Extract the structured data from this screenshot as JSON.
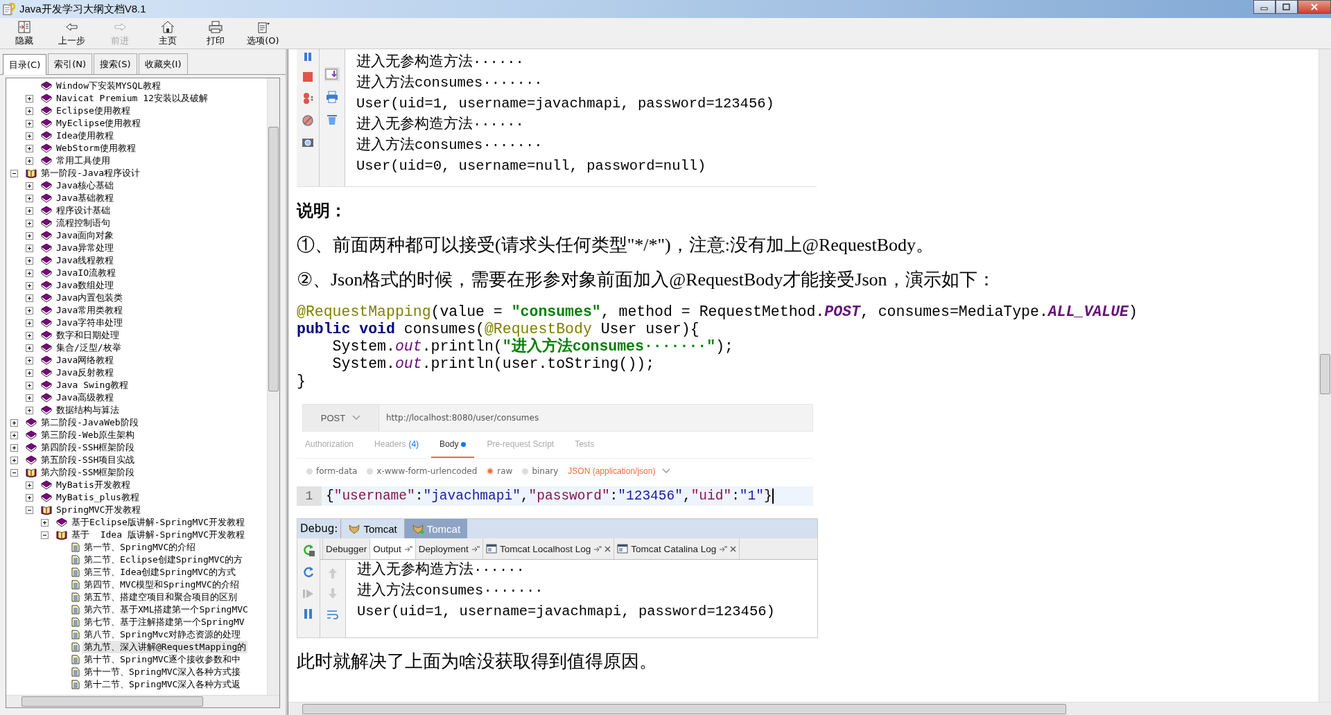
{
  "window": {
    "title": "Java开发学习大纲文档V8.1"
  },
  "toolbar": [
    {
      "label": "隐藏",
      "kind": "hide",
      "disabled": false
    },
    {
      "label": "上一步",
      "kind": "back",
      "disabled": false
    },
    {
      "label": "前进",
      "kind": "forward",
      "disabled": true
    },
    {
      "label": "主页",
      "kind": "home",
      "disabled": false
    },
    {
      "label": "打印",
      "kind": "print",
      "disabled": false
    },
    {
      "label": "选项(O)",
      "kind": "options",
      "disabled": false
    }
  ],
  "nav_tabs": [
    {
      "label": "目录(C)",
      "selected": true
    },
    {
      "label": "索引(N)",
      "selected": false
    },
    {
      "label": "搜索(S)",
      "selected": false
    },
    {
      "label": "收藏夹(I)",
      "selected": false
    }
  ],
  "tree": {
    "scrolled_items": [
      {
        "label": "Window下安装MYSQL教程",
        "kind": "book",
        "selected": false
      },
      {
        "label": "Navicat Premium 12安装以及破解",
        "kind": "book",
        "expanded": false,
        "selected": false
      },
      {
        "label": "Eclipse使用教程",
        "kind": "book",
        "expanded": false,
        "selected": false
      },
      {
        "label": "MyEclipse使用教程",
        "kind": "book",
        "expanded": false,
        "selected": false
      },
      {
        "label": "Idea使用教程",
        "kind": "book",
        "expanded": false,
        "selected": false
      },
      {
        "label": "WebStorm使用教程",
        "kind": "book",
        "expanded": false,
        "selected": false
      },
      {
        "label": "常用工具使用",
        "kind": "book",
        "expanded": false,
        "selected": false
      }
    ],
    "items": [
      {
        "label": "第一阶段-Java程序设计",
        "kind": "open-book",
        "expanded": true,
        "selected": false,
        "children": [
          {
            "label": "Java核心基础",
            "kind": "book",
            "expanded": false,
            "selected": false
          },
          {
            "label": "Java基础教程",
            "kind": "book",
            "expanded": false,
            "selected": false
          },
          {
            "label": "程序设计基础",
            "kind": "book",
            "expanded": false,
            "selected": false
          },
          {
            "label": "流程控制语句",
            "kind": "book",
            "expanded": false,
            "selected": false
          },
          {
            "label": "Java面向对象",
            "kind": "book",
            "expanded": false,
            "selected": false
          },
          {
            "label": "Java异常处理",
            "kind": "book",
            "expanded": false,
            "selected": false
          },
          {
            "label": "Java线程教程",
            "kind": "book",
            "expanded": false,
            "selected": false
          },
          {
            "label": "JavaIO流教程",
            "kind": "book",
            "expanded": false,
            "selected": false
          },
          {
            "label": "Java数组处理",
            "kind": "book",
            "expanded": false,
            "selected": false
          },
          {
            "label": "Java内置包装类",
            "kind": "book",
            "expanded": false,
            "selected": false
          },
          {
            "label": "Java常用类教程",
            "kind": "book",
            "expanded": false,
            "selected": false
          },
          {
            "label": "Java字符串处理",
            "kind": "book",
            "expanded": false,
            "selected": false
          },
          {
            "label": "数字和日期处理",
            "kind": "book",
            "expanded": false,
            "selected": false
          },
          {
            "label": "集合/泛型/枚举",
            "kind": "book",
            "expanded": false,
            "selected": false
          },
          {
            "label": "Java网络教程",
            "kind": "book",
            "expanded": false,
            "selected": false
          },
          {
            "label": "Java反射教程",
            "kind": "book",
            "expanded": false,
            "selected": false
          },
          {
            "label": "Java Swing教程",
            "kind": "book",
            "expanded": false,
            "selected": false
          },
          {
            "label": "Java高级教程",
            "kind": "book",
            "expanded": false,
            "selected": false
          },
          {
            "label": "数据结构与算法",
            "kind": "book",
            "expanded": false,
            "selected": false
          }
        ]
      },
      {
        "label": "第二阶段-JavaWeb阶段",
        "kind": "book",
        "expanded": false,
        "selected": false
      },
      {
        "label": "第三阶段-Web原生架构",
        "kind": "book",
        "expanded": false,
        "selected": false
      },
      {
        "label": "第四阶段-SSH框架阶段",
        "kind": "book",
        "expanded": false,
        "selected": false
      },
      {
        "label": "第五阶段-SSH项目实战",
        "kind": "book",
        "expanded": false,
        "selected": false
      },
      {
        "label": "第六阶段-SSM框架阶段",
        "kind": "open-book",
        "expanded": true,
        "selected": false,
        "children": [
          {
            "label": "MyBatis开发教程",
            "kind": "book",
            "expanded": false,
            "selected": false
          },
          {
            "label": "MyBatis_plus教程",
            "kind": "book",
            "expanded": false,
            "selected": false
          },
          {
            "label": "SpringMVC开发教程",
            "kind": "open-book",
            "expanded": true,
            "selected": false,
            "children": [
              {
                "label": "基于Eclipse版讲解-SpringMVC开发教程",
                "kind": "book",
                "expanded": false,
                "selected": false
              },
              {
                "label": "基于  Idea 版讲解-SpringMVC开发教程",
                "kind": "open-book",
                "expanded": true,
                "selected": false,
                "children": [
                  {
                    "label": "第一节、SpringMVC的介绍",
                    "kind": "page",
                    "selected": false
                  },
                  {
                    "label": "第二节、Eclipse创建SpringMVC的方",
                    "kind": "page",
                    "selected": false
                  },
                  {
                    "label": "第三节、Idea创建SpringMVC的方式",
                    "kind": "page",
                    "selected": false
                  },
                  {
                    "label": "第四节、MVC模型和SpringMVC的介绍",
                    "kind": "page",
                    "selected": false
                  },
                  {
                    "label": "第五节、搭建空项目和聚合项目的区别",
                    "kind": "page",
                    "selected": false
                  },
                  {
                    "label": "第六节、基于XML搭建第一个SpringMVC",
                    "kind": "page",
                    "selected": false
                  },
                  {
                    "label": "第七节、基于注解搭建第一个SpringMV",
                    "kind": "page",
                    "selected": false
                  },
                  {
                    "label": "第八节、SpringMvc对静态资源的处理",
                    "kind": "page",
                    "selected": false
                  },
                  {
                    "label": "第九节、深入讲解@RequestMapping的",
                    "kind": "page",
                    "selected": true
                  },
                  {
                    "label": "第十节、SpringMVC逐个接收参数和中",
                    "kind": "page",
                    "selected": false
                  },
                  {
                    "label": "第十一节、SpringMVC深入各种方式接",
                    "kind": "page",
                    "selected": false
                  },
                  {
                    "label": "第十二节、SpringMVC深入各种方式返",
                    "kind": "page",
                    "selected": false
                  }
                ]
              }
            ]
          }
        ]
      }
    ]
  },
  "document": [
    {
      "kind": "console",
      "lines": [
        "进入无参构造方法······",
        "进入方法consumes·······",
        "User(uid=1, username=javachmapi, password=123456)",
        "进入无参构造方法······",
        "进入方法consumes·······",
        "User(uid=0, username=null, password=null)"
      ]
    },
    {
      "kind": "heading",
      "text": "说明："
    },
    {
      "kind": "paragraph",
      "text": "①、前面两种都可以接受(请求头任何类型\"*/*\")，注意:没有加上@RequestBody。"
    },
    {
      "kind": "paragraph",
      "text": "②、Json格式的时候，需要在形参对象前面加入@RequestBody才能接受Json，演示如下："
    },
    {
      "kind": "code",
      "lines": [
        [
          {
            "kind": "annotation",
            "text": "@RequestMapping"
          },
          {
            "kind": "plain",
            "text": "(value = "
          },
          {
            "kind": "string",
            "text": "\"consumes\""
          },
          {
            "kind": "plain",
            "text": ", method = RequestMethod."
          },
          {
            "kind": "constant",
            "text": "POST"
          },
          {
            "kind": "plain",
            "text": ", consumes=MediaType."
          },
          {
            "kind": "constant",
            "text": "ALL_VALUE"
          },
          {
            "kind": "plain",
            "text": ")"
          }
        ],
        [
          {
            "kind": "keyword",
            "text": "public void"
          },
          {
            "kind": "plain",
            "text": " consumes("
          },
          {
            "kind": "annotation",
            "text": "@RequestBody"
          },
          {
            "kind": "plain",
            "text": " User user){"
          }
        ],
        [
          {
            "kind": "plain",
            "text": "    System."
          },
          {
            "kind": "static",
            "text": "out"
          },
          {
            "kind": "plain",
            "text": ".println("
          },
          {
            "kind": "string",
            "text": "\"进入方法consumes·······\""
          },
          {
            "kind": "plain",
            "text": ");"
          }
        ],
        [
          {
            "kind": "plain",
            "text": "    System."
          },
          {
            "kind": "static",
            "text": "out"
          },
          {
            "kind": "plain",
            "text": ".println(user.toString());"
          }
        ],
        [
          {
            "kind": "plain",
            "text": "}"
          }
        ]
      ]
    },
    {
      "kind": "postman",
      "method": "POST",
      "url": "http://localhost:8080/user/consumes",
      "tabs": [
        {
          "label": "Authorization",
          "selected": false,
          "modified": false
        },
        {
          "label": "Headers",
          "count": "(4)",
          "selected": false,
          "modified": false
        },
        {
          "label": "Body",
          "selected": true,
          "modified": true
        },
        {
          "label": "Pre-request Script",
          "selected": false,
          "modified": false
        },
        {
          "label": "Tests",
          "selected": false,
          "modified": false
        }
      ],
      "body_types": [
        {
          "label": "form-data",
          "selected": false
        },
        {
          "label": "x-www-form-urlencoded",
          "selected": false
        },
        {
          "label": "raw",
          "selected": true
        },
        {
          "label": "binary",
          "selected": false
        }
      ],
      "format": "JSON (application/json)",
      "line_number": "1",
      "tokens": [
        {
          "kind": "punct",
          "text": "{"
        },
        {
          "kind": "key",
          "text": "\"username\""
        },
        {
          "kind": "punct",
          "text": ":"
        },
        {
          "kind": "value",
          "text": "\"javachmapi\""
        },
        {
          "kind": "punct",
          "text": ","
        },
        {
          "kind": "key",
          "text": "\"password\""
        },
        {
          "kind": "punct",
          "text": ":"
        },
        {
          "kind": "value",
          "text": "\"123456\""
        },
        {
          "kind": "punct",
          "text": ","
        },
        {
          "kind": "key",
          "text": "\"uid\""
        },
        {
          "kind": "punct",
          "text": ":"
        },
        {
          "kind": "value",
          "text": "\"1\""
        },
        {
          "kind": "punct",
          "text": "}"
        }
      ]
    },
    {
      "kind": "debug",
      "label": "Debug:",
      "sessions": [
        {
          "label": "Tomcat",
          "selected": false
        },
        {
          "label": "Tomcat",
          "selected": true
        }
      ],
      "tabs": [
        {
          "label": "Debugger",
          "kind": "plain",
          "selected": false
        },
        {
          "label": "Output",
          "kind": "pinned",
          "selected": true
        },
        {
          "label": "Deployment",
          "kind": "pinned",
          "selected": false
        },
        {
          "label": "Tomcat Localhost Log",
          "kind": "log",
          "selected": false
        },
        {
          "label": "Tomcat Catalina Log",
          "kind": "log",
          "selected": false
        }
      ],
      "lines": [
        "进入无参构造方法······",
        "进入方法consumes·······",
        "User(uid=1, username=javachmapi, password=123456)"
      ]
    },
    {
      "kind": "paragraph",
      "text": "此时就解决了上面为啥没获取得到值得原因。"
    }
  ]
}
